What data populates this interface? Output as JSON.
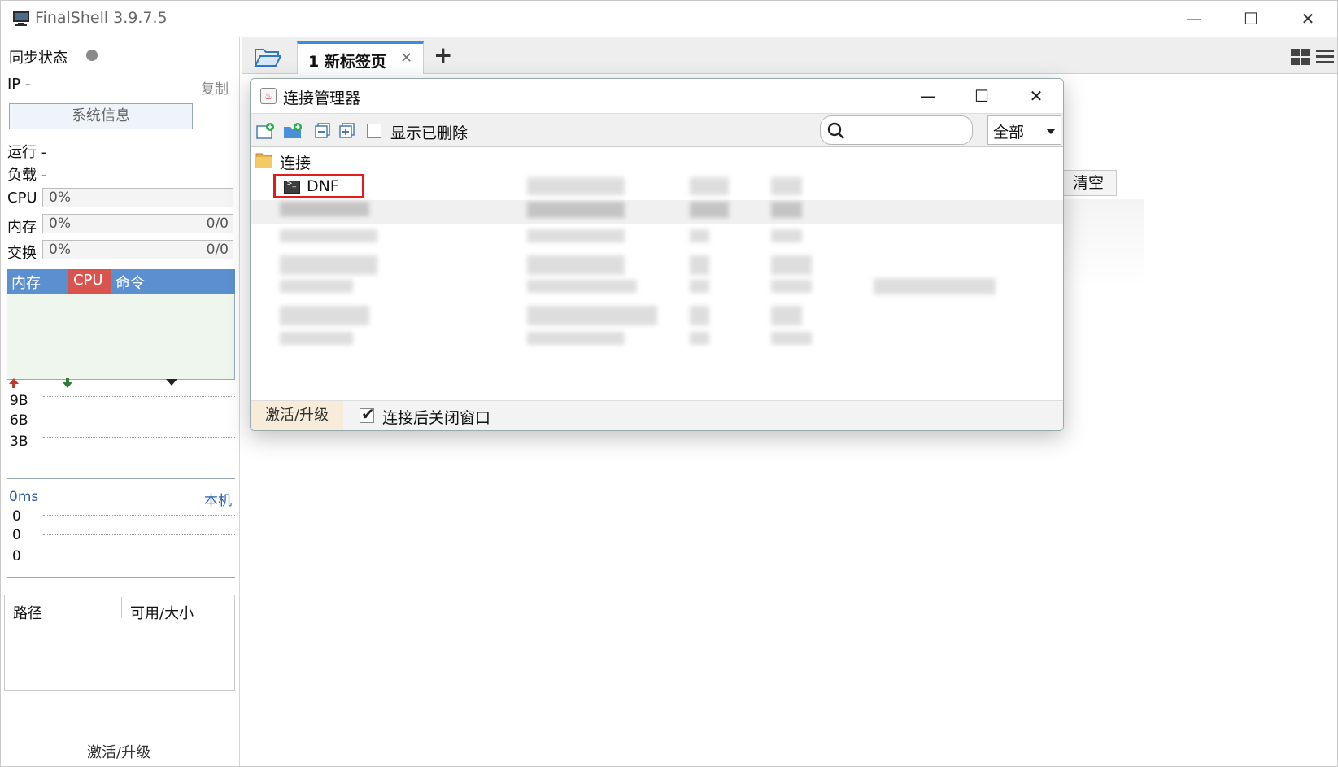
{
  "window": {
    "title": "FinalShell 3.9.7.5",
    "minimize": "—",
    "maximize": "☐",
    "close": "✕"
  },
  "left": {
    "sync_label": "同步状态",
    "ip_label": "IP  -",
    "copy": "复制",
    "sysinfo": "系统信息",
    "run": "运行 -",
    "load": "负载 -",
    "cpu_label": "CPU",
    "cpu_pct": "0%",
    "mem_label": "内存",
    "mem_pct": "0%",
    "mem_ratio": "0/0",
    "swap_label": "交换",
    "swap_pct": "0%",
    "swap_ratio": "0/0",
    "tabs": [
      "内存",
      "CPU",
      "命令"
    ],
    "net_scale": [
      "9B",
      "6B",
      "3B"
    ],
    "ping_label": "0ms",
    "ping_target": "本机",
    "ping_scale": [
      "0",
      "0",
      "0"
    ],
    "fs_headers": [
      "路径",
      "可用/大小"
    ],
    "activate": "激活/升级"
  },
  "tabs": {
    "tab1": "1 新标签页",
    "close": "✕",
    "add": "+"
  },
  "main": {
    "clear": "清空"
  },
  "dialog": {
    "title": "连接管理器",
    "minimize": "—",
    "maximize": "☐",
    "close": "✕",
    "show_deleted": "显示已删除",
    "search_placeholder": "",
    "filter_value": "全部",
    "tree_root": "连接",
    "highlighted_item": "DNF",
    "activate": "激活/升级",
    "close_after_connect": "连接后关闭窗口"
  },
  "colors": {
    "accent_blue": "#3c8be3",
    "cpu_red": "#d9534f",
    "highlight_red": "#e21c1c",
    "tab_blue": "#5a8fd0"
  }
}
